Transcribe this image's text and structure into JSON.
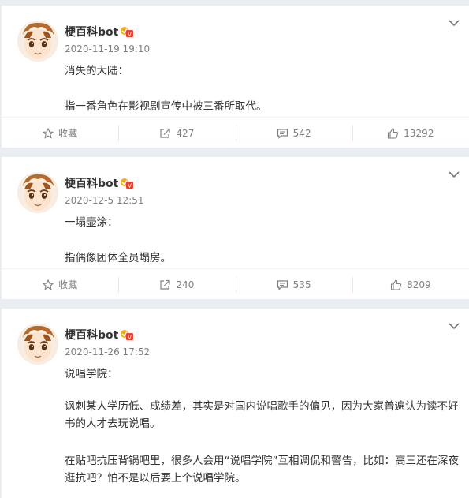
{
  "posts": [
    {
      "username": "梗百科bot",
      "time": "2020-11-19 19:10",
      "title": "消失的大陆：",
      "body": "指一番角色在影视剧宣传中被三番所取代。",
      "actions": {
        "collect": "收藏",
        "repost": "427",
        "comment": "542",
        "like": "13292"
      }
    },
    {
      "username": "梗百科bot",
      "time": "2020-12-5 12:51",
      "title": "一塌壶涂：",
      "body": "指偶像团体全员塌房。",
      "actions": {
        "collect": "收藏",
        "repost": "240",
        "comment": "535",
        "like": "8209"
      }
    },
    {
      "username": "梗百科bot",
      "time": "2020-11-26 17:52",
      "title": "说唱学院：",
      "para1": "讽刺某人学历低、成绩差，其实是对国内说唱歌手的偏见，因为大家普遍认为读不好书的人才去玩说唱。",
      "para2": "在贴吧抗压背锅吧里，很多人会用“说唱学院”互相调侃和警告，比如：高三还在深夜逛抗吧？怕不是以后要上个说唱学院。"
    }
  ]
}
